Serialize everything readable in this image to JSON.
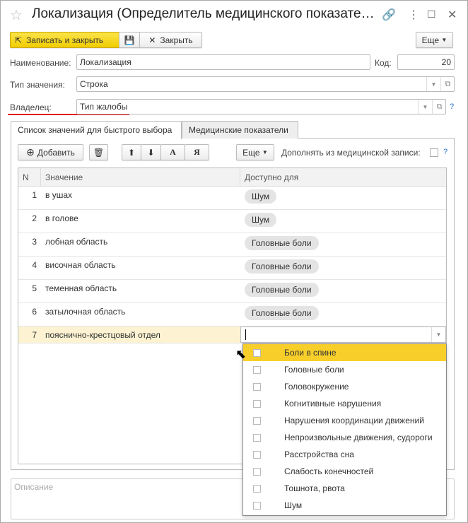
{
  "window": {
    "title": "Локализация (Определитель медицинского показате…"
  },
  "toolbar": {
    "save_close": "Записать и закрыть",
    "close": "Закрыть",
    "more": "Еще"
  },
  "form": {
    "name_label": "Наименование:",
    "name_value": "Локализация",
    "code_label": "Код:",
    "code_value": "20",
    "type_label": "Тип значения:",
    "type_value": "Строка",
    "owner_label": "Владелец:",
    "owner_value": "Тип жалобы",
    "help": "?"
  },
  "tabs": [
    {
      "label": "Список значений для быстрого выбора"
    },
    {
      "label": "Медицинские показатели"
    }
  ],
  "list_toolbar": {
    "add": "Добавить",
    "sort_asc": "А",
    "sort_desc": "Я",
    "more": "Еще",
    "supplement_label": "Дополнять из медицинской записи:",
    "help": "?"
  },
  "table": {
    "headers": [
      "N",
      "Значение",
      "Доступно для"
    ],
    "rows": [
      {
        "n": "1",
        "value": "в ушах",
        "avail": "Шум"
      },
      {
        "n": "2",
        "value": "в голове",
        "avail": "Шум"
      },
      {
        "n": "3",
        "value": "лобная область",
        "avail": "Головные боли"
      },
      {
        "n": "4",
        "value": "височная область",
        "avail": "Головные боли"
      },
      {
        "n": "5",
        "value": "теменная область",
        "avail": "Головные боли"
      },
      {
        "n": "6",
        "value": "затылочная область",
        "avail": "Головные боли"
      },
      {
        "n": "7",
        "value": "пояснично-крестцовый отдел",
        "avail": ""
      }
    ]
  },
  "dropdown": {
    "items": [
      "Боли в спине",
      "Головные боли",
      "Головокружение",
      "Когнитивные нарушения",
      "Нарушения координации движений",
      "Непроизвольные движения, судороги",
      "Расстройства сна",
      "Слабость конечностей",
      "Тошнота, рвота",
      "Шум"
    ],
    "selected": 0
  },
  "description": {
    "placeholder": "Описание"
  },
  "colors": {
    "accent": "#f8cf2a",
    "underline": "#e00000"
  }
}
